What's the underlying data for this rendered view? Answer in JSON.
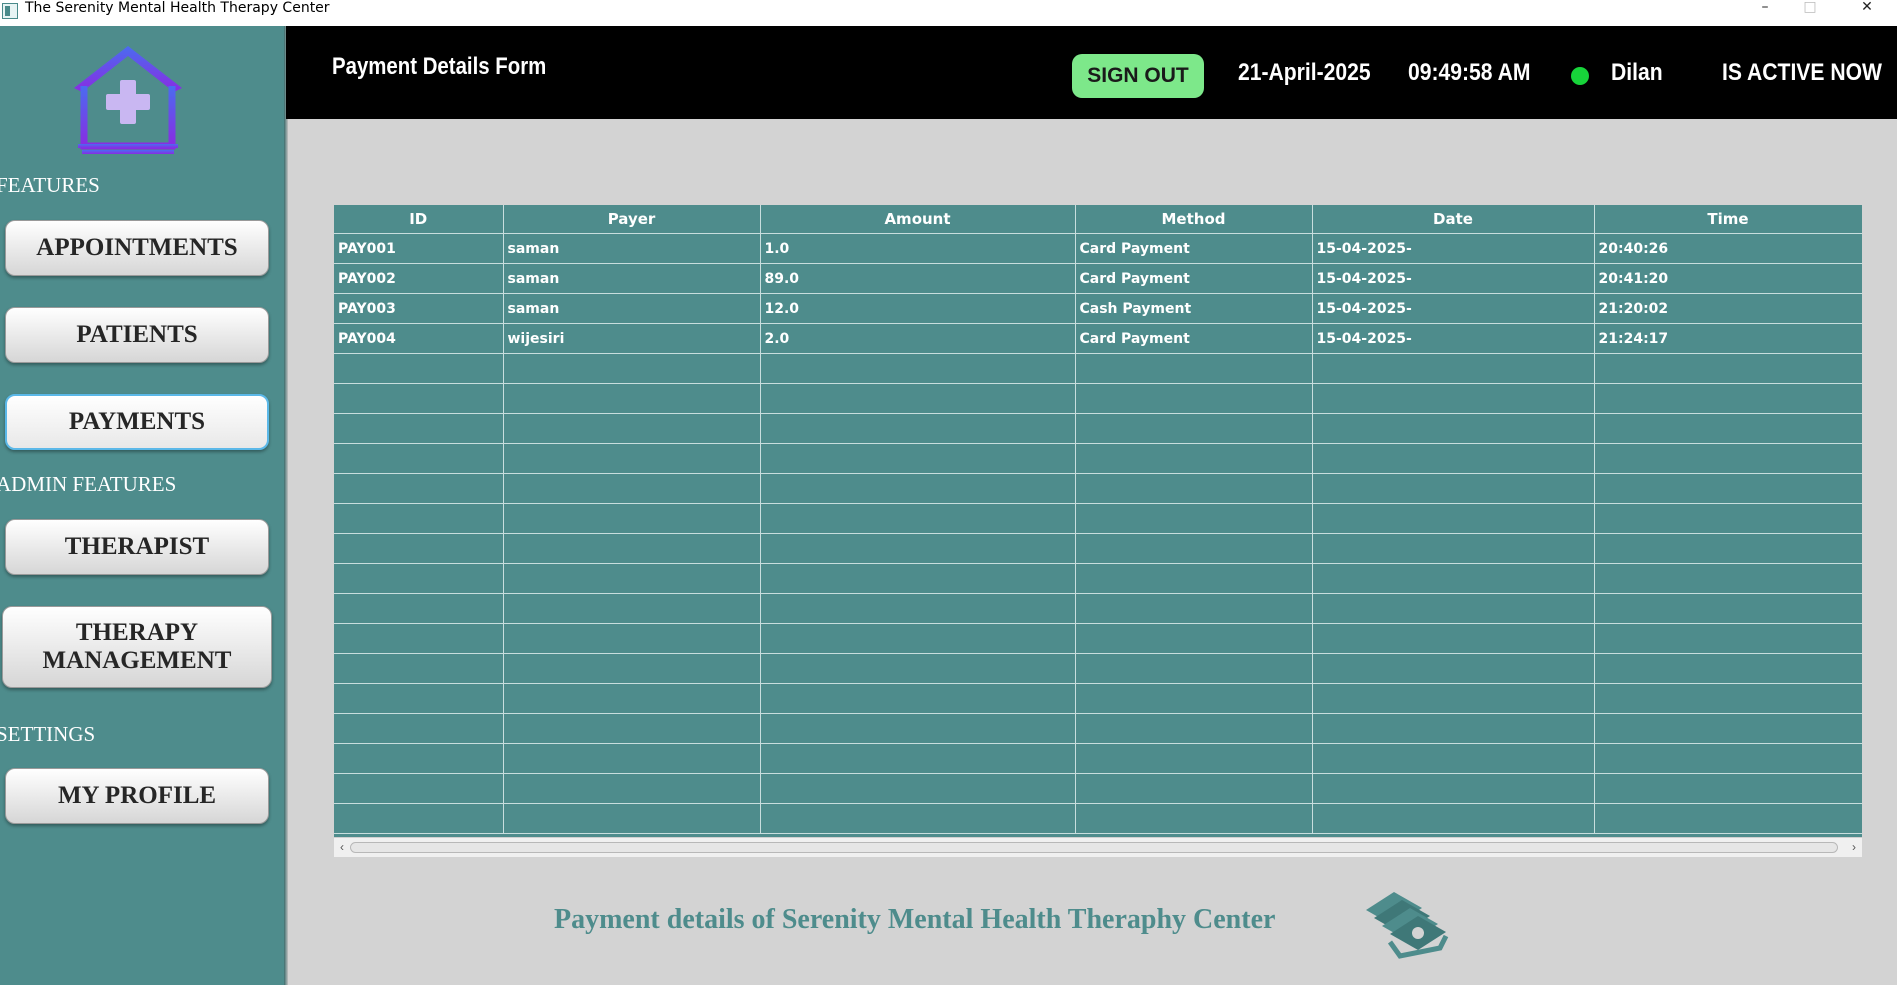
{
  "window": {
    "title": "The Serenity Mental Health Therapy Center",
    "controls": {
      "minimize": "–",
      "maximize": "□",
      "close": "✕"
    }
  },
  "sidebar": {
    "logo_icon": "house-medical-cross-icon",
    "features_label": "FEATURES",
    "admin_label": "ADMIN FEATURES",
    "settings_label": "SETTINGS",
    "buttons": {
      "appointments": "APPOINTMENTS",
      "patients": "PATIENTS",
      "payments": "PAYMENTS",
      "therapist": "THERAPIST",
      "therapy_management": "THERAPY MANAGEMENT",
      "my_profile": "MY PROFILE"
    },
    "active": "PAYMENTS"
  },
  "header": {
    "form_title": "Payment Details Form",
    "sign_out": "SIGN OUT",
    "date": "21-April-2025",
    "time": "09:49:58  AM",
    "user": "Dilan",
    "status": "IS ACTIVE NOW"
  },
  "table": {
    "columns": [
      "ID",
      "Payer",
      "Amount",
      "Method",
      "Date",
      "Time"
    ],
    "rows": [
      [
        "PAY001",
        "saman",
        "1.0",
        "Card Payment",
        "15-04-2025-",
        "20:40:26"
      ],
      [
        "PAY002",
        "saman",
        "89.0",
        "Card Payment",
        "15-04-2025-",
        "20:41:20"
      ],
      [
        "PAY003",
        "saman",
        "12.0",
        "Cash Payment",
        "15-04-2025-",
        "21:20:02"
      ],
      [
        "PAY004",
        "wijesiri",
        "2.0",
        "Card Payment",
        "15-04-2025-",
        "21:24:17"
      ]
    ],
    "empty_rows": 16
  },
  "scrollbar": {
    "left_arrow": "‹",
    "right_arrow": "›"
  },
  "footer": {
    "text": "Payment details of Serenity Mental Health Theraphy Center",
    "icon": "money-cash-icon"
  },
  "colors": {
    "teal": "#4e8c8c",
    "header_bg": "#000000",
    "sign_out_bg": "#7de88a",
    "active_dot": "#17d43a",
    "logo_purple": "#8a2be2",
    "logo_blue": "#4a6cf0"
  }
}
